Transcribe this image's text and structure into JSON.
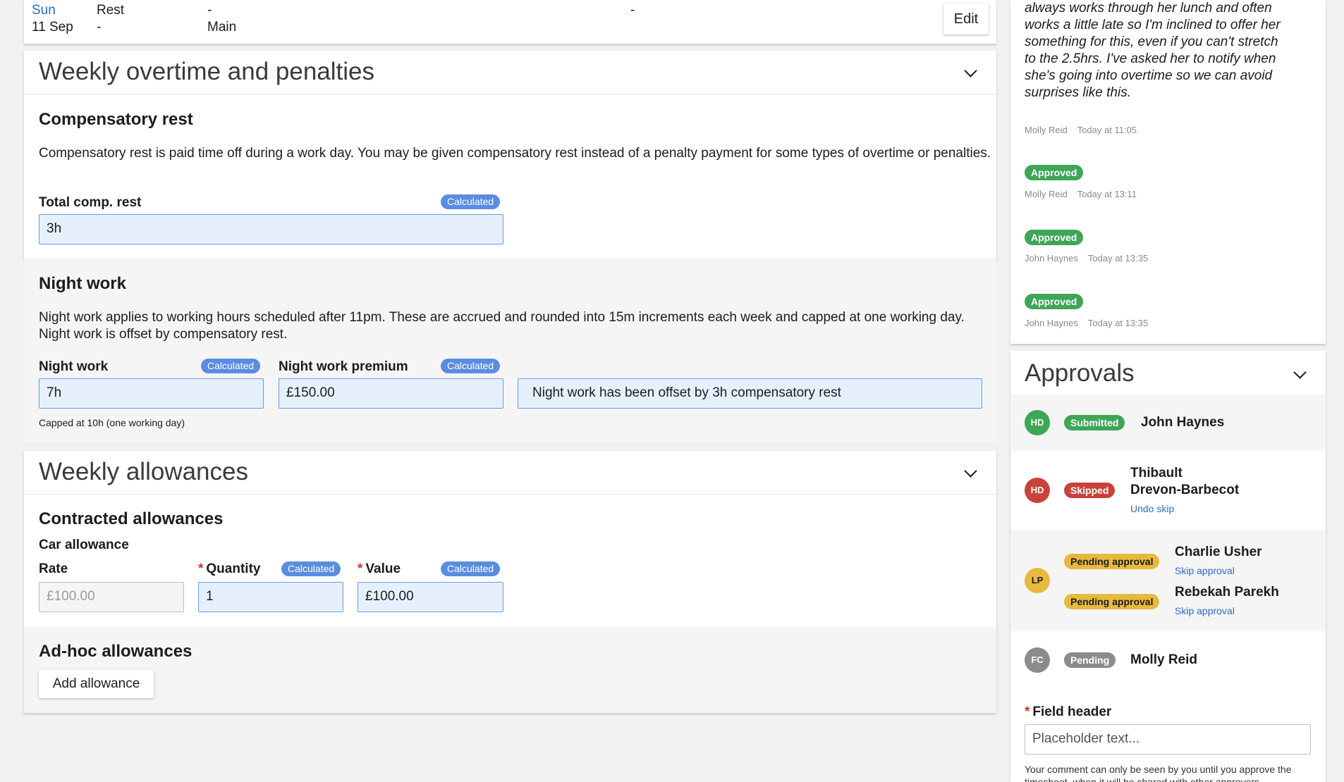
{
  "day_row": {
    "day": "Sun",
    "date": "11 Sep",
    "col1_top": "Rest",
    "col1_bottom": "-",
    "col2_top": "-",
    "col2_bottom": "Main",
    "col3_top": "-",
    "edit_label": "Edit"
  },
  "overtime": {
    "title": "Weekly overtime and penalties",
    "comp_rest": {
      "heading": "Compensatory rest",
      "description": "Compensatory rest is paid time off during a work day. You may be given compensatory rest instead of a penalty payment for some types of overtime or penalties.",
      "total_label": "Total comp. rest",
      "badge": "Calculated",
      "total_value": "3h"
    },
    "night_work": {
      "heading": "Night work",
      "description": "Night work applies to working hours scheduled after 11pm. These are accrued and rounded into 15m increments each week and capped at one working day. Night work is offset by compensatory rest.",
      "hours_label": "Night work",
      "hours_badge": "Calculated",
      "hours_value": "7h",
      "premium_label": "Night work premium",
      "premium_badge": "Calculated",
      "premium_value": "£150.00",
      "info": "Night work has been offset by 3h compensatory rest",
      "cap_note": "Capped at 10h (one working day)"
    }
  },
  "allowances": {
    "title": "Weekly allowances",
    "contracted": {
      "heading": "Contracted allowances",
      "subheading": "Car allowance",
      "rate_label": "Rate",
      "rate_value": "£100.00",
      "quantity_label": "Quantity",
      "quantity_badge": "Calculated",
      "quantity_value": "1",
      "value_label": "Value",
      "value_badge": "Calculated",
      "value_value": "£100.00",
      "required_mark": "*"
    },
    "adhoc": {
      "heading": "Ad-hoc allowances",
      "add_label": "Add allowance"
    }
  },
  "comments": {
    "text": "always works through her lunch and often works a little late so I'm inclined to offer her something for this, even if you can't stretch to the 2.5hrs. I've asked her to notify when she's going into overtime so we can avoid surprises like this.",
    "text_author": "Molly Reid",
    "text_time": "Today at 11:05",
    "events": [
      {
        "status": "Approved",
        "author": "Molly Reid",
        "time": "Today at 13:11"
      },
      {
        "status": "Approved",
        "author": "John Haynes",
        "time": "Today at 13:35"
      },
      {
        "status": "Approved",
        "author": "John Haynes",
        "time": "Today at 13:35"
      }
    ]
  },
  "approvals": {
    "title": "Approvals",
    "rows": [
      {
        "initials": "HD",
        "status": "Submitted",
        "name": "John Haynes"
      },
      {
        "initials": "HD",
        "status": "Skipped",
        "name_line1": "Thibault",
        "name_line2": "Drevon-Barbecot",
        "link": "Undo skip"
      },
      {
        "initials": "LP",
        "approvers": [
          {
            "status": "Pending approval",
            "name": "Charlie Usher",
            "link": "Skip approval"
          },
          {
            "status": "Pending approval",
            "name": "Rebekah Parekh",
            "link": "Skip approval"
          }
        ]
      },
      {
        "initials": "FC",
        "status": "Pending",
        "name": "Molly Reid"
      }
    ],
    "field_label": "Field header",
    "required_mark": "*",
    "field_placeholder": "Placeholder text...",
    "help_text": "Your comment can only be seen by you until you approve the timesheet, when it will be shared with other approvers."
  },
  "colors": {
    "accent_blue": "#2b6cc4",
    "calculated_badge": "#5a8de0",
    "approved_green": "#3fa557",
    "skipped_red": "#c8423b",
    "pending_amber": "#e8b93f",
    "pending_grey": "#8b8b8b"
  }
}
